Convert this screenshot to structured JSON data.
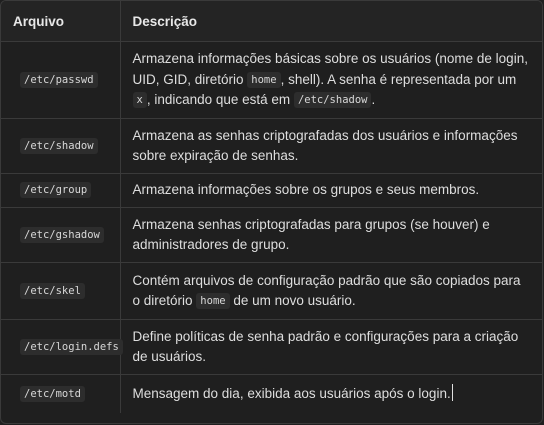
{
  "table": {
    "headers": [
      "Arquivo",
      "Descrição"
    ],
    "rows": [
      {
        "file": "/etc/passwd",
        "desc_1": "Armazena informações básicas sobre os usuários (nome de login, UID, GID, diretório ",
        "code_1": "home",
        "desc_2": ", shell). A senha é representada por um ",
        "code_2": "x",
        "desc_3": ", indicando que está em ",
        "code_3": "/etc/shadow",
        "desc_4": "."
      },
      {
        "file": "/etc/shadow",
        "desc": "Armazena as senhas criptografadas dos usuários e informações sobre expiração de senhas."
      },
      {
        "file": "/etc/group",
        "desc": "Armazena informações sobre os grupos e seus membros."
      },
      {
        "file": "/etc/gshadow",
        "desc": "Armazena senhas criptografadas para grupos (se houver) e administradores de grupo."
      },
      {
        "file": "/etc/skel",
        "desc_1": "Contém arquivos de configuração padrão que são copiados para o diretório ",
        "code_1": "home",
        "desc_2": " de um novo usuário."
      },
      {
        "file": "/etc/login.defs",
        "desc": "Define políticas de senha padrão e configurações para a criação de usuários."
      },
      {
        "file": "/etc/motd",
        "desc": "Mensagem do dia, exibida aos usuários após o login."
      }
    ]
  }
}
